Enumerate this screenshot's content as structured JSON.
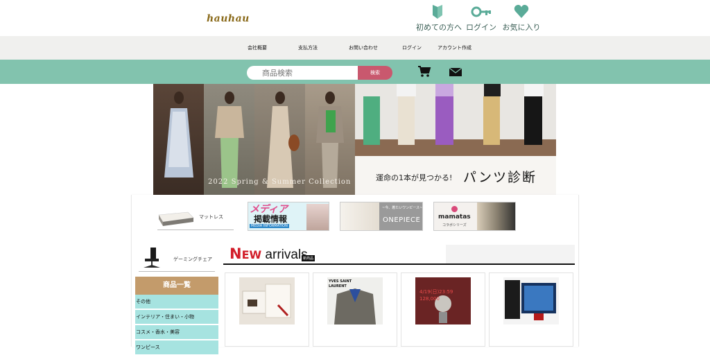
{
  "header": {
    "logo": "hauhau",
    "links": [
      {
        "label": "初めての方へ",
        "icon": "beginner-leaf-icon"
      },
      {
        "label": "ログイン",
        "icon": "key-icon"
      },
      {
        "label": "お気に入り",
        "icon": "heart-icon"
      }
    ]
  },
  "nav": {
    "items": [
      "会社概要",
      "支払方法",
      "お問い合わせ",
      "ログイン",
      "アカウント作成"
    ]
  },
  "search": {
    "placeholder": "商品検索",
    "button_label": "検索"
  },
  "hero": {
    "left_caption": "2022 Spring & Summer Collection",
    "right_small": "運命の1本が見つかる!",
    "right_big": "パンツ診断"
  },
  "categories": {
    "mattress": "マットレス",
    "gaming_chair": "ゲーミングチェア"
  },
  "banners": {
    "media_title": "メディア",
    "media_sub": "掲載情報",
    "media_en": "MEDIA INFORMATION",
    "onepiece": "ONEPIECE",
    "onepiece_sub": "~今、着たいワンピース~",
    "mamatas": "mamatas",
    "mamatas_sub": "コラボシリーズ"
  },
  "new_arrivals": {
    "title_n": "N",
    "title_ew": "EW",
    "title_rest": " arrivals",
    "badge": "新商品"
  },
  "sidebar": {
    "heading": "商品一覧",
    "items": [
      "その他",
      "インテリア・住まい・小物",
      "コスメ・香水・美容",
      "ワンピース"
    ]
  },
  "products": [
    {
      "thumb_text": ""
    },
    {
      "thumb_text": "YVES SAINT LAURENT"
    },
    {
      "thumb_text": "4/19(日)23:59 128,000"
    },
    {
      "thumb_text": ""
    }
  ],
  "colors": {
    "accent_green": "#82c3ae",
    "search_button": "#c9586e",
    "sidebar_head": "#c39b6b",
    "sidebar_item": "#a6e3e0",
    "new_red": "#d21e2a"
  }
}
